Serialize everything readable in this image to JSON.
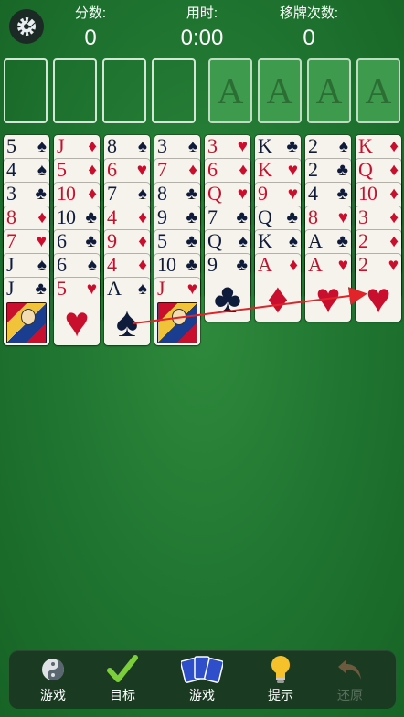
{
  "header": {
    "score_label": "分数:",
    "score_value": "0",
    "time_label": "用时:",
    "time_value": "0:00",
    "moves_label": "移牌次数:",
    "moves_value": "0"
  },
  "foundations": [
    "A",
    "A",
    "A",
    "A"
  ],
  "tableau": [
    [
      {
        "r": "5",
        "s": "♠"
      },
      {
        "r": "4",
        "s": "♠"
      },
      {
        "r": "3",
        "s": "♣"
      },
      {
        "r": "8",
        "s": "♦"
      },
      {
        "r": "7",
        "s": "♥"
      },
      {
        "r": "J",
        "s": "♠"
      },
      {
        "r": "J",
        "s": "♣"
      }
    ],
    [
      {
        "r": "J",
        "s": "♦"
      },
      {
        "r": "5",
        "s": "♦"
      },
      {
        "r": "10",
        "s": "♦"
      },
      {
        "r": "10",
        "s": "♣"
      },
      {
        "r": "6",
        "s": "♣"
      },
      {
        "r": "6",
        "s": "♠"
      },
      {
        "r": "5",
        "s": "♥"
      }
    ],
    [
      {
        "r": "8",
        "s": "♠"
      },
      {
        "r": "6",
        "s": "♥"
      },
      {
        "r": "7",
        "s": "♠"
      },
      {
        "r": "4",
        "s": "♦"
      },
      {
        "r": "9",
        "s": "♦"
      },
      {
        "r": "4",
        "s": "♦"
      },
      {
        "r": "A",
        "s": "♠"
      }
    ],
    [
      {
        "r": "3",
        "s": "♠"
      },
      {
        "r": "7",
        "s": "♦"
      },
      {
        "r": "8",
        "s": "♣"
      },
      {
        "r": "9",
        "s": "♣"
      },
      {
        "r": "5",
        "s": "♣"
      },
      {
        "r": "10",
        "s": "♣"
      },
      {
        "r": "J",
        "s": "♥"
      }
    ],
    [
      {
        "r": "3",
        "s": "♥"
      },
      {
        "r": "6",
        "s": "♦"
      },
      {
        "r": "Q",
        "s": "♥"
      },
      {
        "r": "7",
        "s": "♣"
      },
      {
        "r": "Q",
        "s": "♠"
      },
      {
        "r": "9",
        "s": "♣"
      }
    ],
    [
      {
        "r": "K",
        "s": "♣"
      },
      {
        "r": "K",
        "s": "♥"
      },
      {
        "r": "9",
        "s": "♥"
      },
      {
        "r": "Q",
        "s": "♣"
      },
      {
        "r": "K",
        "s": "♠"
      },
      {
        "r": "A",
        "s": "♦"
      }
    ],
    [
      {
        "r": "2",
        "s": "♠"
      },
      {
        "r": "2",
        "s": "♣"
      },
      {
        "r": "4",
        "s": "♣"
      },
      {
        "r": "8",
        "s": "♥"
      },
      {
        "r": "A",
        "s": "♣"
      },
      {
        "r": "A",
        "s": "♥"
      }
    ],
    [
      {
        "r": "K",
        "s": "♦"
      },
      {
        "r": "Q",
        "s": "♦"
      },
      {
        "r": "10",
        "s": "♦"
      },
      {
        "r": "3",
        "s": "♦"
      },
      {
        "r": "2",
        "s": "♦"
      },
      {
        "r": "2",
        "s": "♥"
      }
    ]
  ],
  "hint_arrow": {
    "from_card": "A♠",
    "to_card": "2♥"
  },
  "toolbar": {
    "items": [
      {
        "label": "游戏",
        "icon": "game-spiral-icon"
      },
      {
        "label": "目标",
        "icon": "checkmark-icon"
      },
      {
        "label": "游戏",
        "icon": "cards-icon"
      },
      {
        "label": "提示",
        "icon": "lightbulb-icon"
      },
      {
        "label": "还原",
        "icon": "undo-icon",
        "disabled": true
      }
    ]
  },
  "colors": {
    "felt": "#1f7430",
    "red": "#c8102e",
    "black": "#0f1b3a",
    "arrow": "#e0242a"
  }
}
